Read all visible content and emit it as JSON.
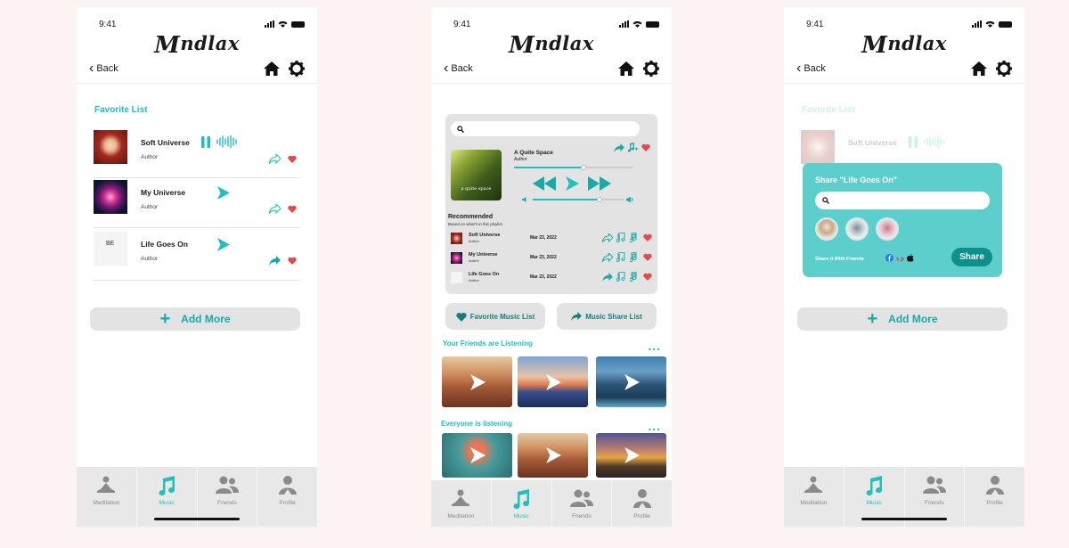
{
  "app": {
    "logo_text": "ndlax",
    "logo_mark": "M",
    "status_time": "9:41",
    "back_label": "Back"
  },
  "screen1": {
    "section_title": "Favorite List",
    "items": [
      {
        "title": "Soft Universe",
        "author": "Author",
        "thumb": "portrait"
      },
      {
        "title": "My Universe",
        "author": "Author",
        "thumb": "flower"
      },
      {
        "title": "Life Goes On",
        "author": "Author",
        "thumb": "album",
        "thumb_text": "BE"
      }
    ],
    "add_more_label": "Add More"
  },
  "player": {
    "title": "A Quite Space",
    "author": "Author",
    "cover_text": "a quite space"
  },
  "recommended": {
    "title": "Recommended",
    "subtitle": "Based on what's in this playlist",
    "items": [
      {
        "title": "Soft Universe",
        "author": "Author",
        "date": "Mar 23, 2022"
      },
      {
        "title": "My Universe",
        "author": "Author",
        "date": "Mar 23, 2022"
      },
      {
        "title": "Life Goes On",
        "author": "Author",
        "date": "Mar 23, 2022"
      }
    ]
  },
  "buttons": {
    "favorite_list": "Favorite Music List",
    "share_list": "Music Share List"
  },
  "friends_section": {
    "title": "Your Friends are Listening",
    "more": "..."
  },
  "everyone_section": {
    "title": "Everyone is listening",
    "more": "..."
  },
  "share_modal": {
    "title": "Share \"Life Goes On\"",
    "footer": "Share it With Friends",
    "button": "Share"
  },
  "tabs": [
    {
      "label": "Meditation",
      "icon": "meditation-icon"
    },
    {
      "label": "Music",
      "icon": "music-note-icon"
    },
    {
      "label": "Friends",
      "icon": "friends-icon"
    },
    {
      "label": "Profile",
      "icon": "profile-icon"
    }
  ],
  "colors": {
    "accent": "#21c0bd",
    "heart": "#e04b4b",
    "modal": "#5ccfcc"
  }
}
